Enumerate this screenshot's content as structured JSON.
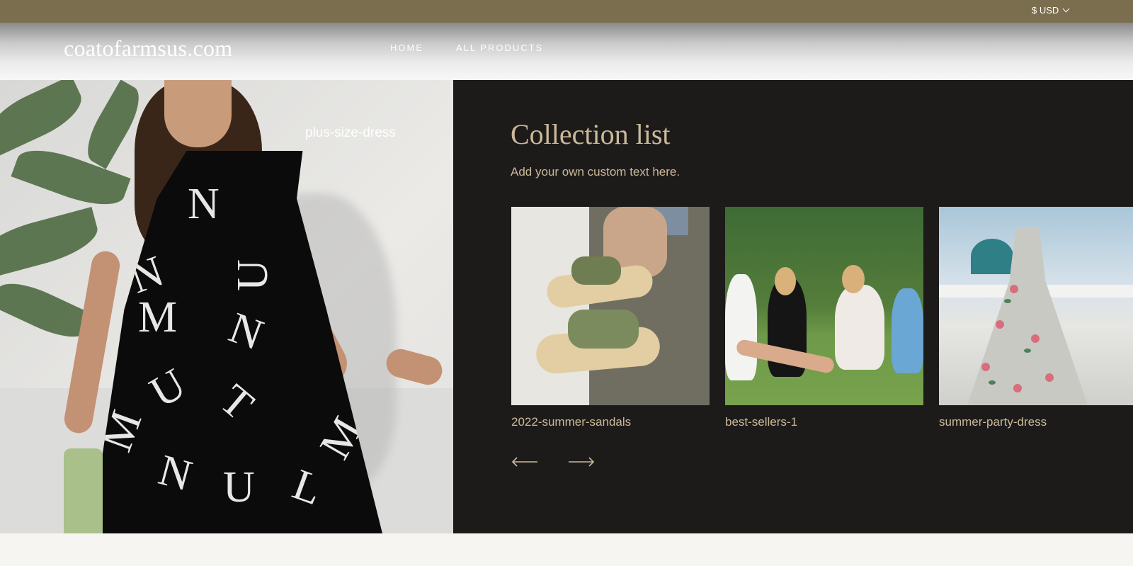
{
  "topbar": {
    "currency": "$ USD"
  },
  "header": {
    "logo": "coatofarmsus.com",
    "nav": [
      {
        "label": "HOME"
      },
      {
        "label": "ALL PRODUCTS"
      }
    ]
  },
  "hero": {
    "caption": "plus-size-dress"
  },
  "collection": {
    "title": "Collection list",
    "description": "Add your own custom text here.",
    "items": [
      {
        "label": "2022-summer-sandals"
      },
      {
        "label": "best-sellers-1"
      },
      {
        "label": "summer-party-dress"
      }
    ]
  },
  "colors": {
    "topbar": "#7b6e4f",
    "dark_panel": "#1d1b1a",
    "accent_text": "#cbb99a",
    "page_bg": "#f6f5f1"
  }
}
